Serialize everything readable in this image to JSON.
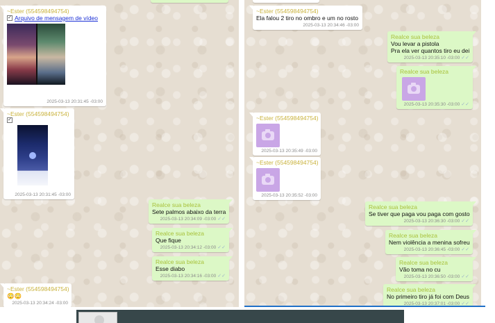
{
  "left_panel": {
    "messages": [
      {
        "id": "m1",
        "direction": "in",
        "kind": "video",
        "sender": "~Ester (554598494754)",
        "attachment_label": "Arquivo de mensagem de vídeo",
        "time": "2025-03-13 20:31:45 -03:00"
      },
      {
        "id": "m2",
        "direction": "in",
        "kind": "image",
        "sender": "~Ester (554598494754)",
        "time": "2025-03-13 20:31:45 -03:00"
      },
      {
        "id": "m3",
        "direction": "out",
        "kind": "text",
        "sender": "Realce sua beleza",
        "text": "Sete palmos abaixo da terra",
        "time": "2025-03-13 20:34:09 -03:00"
      },
      {
        "id": "m4",
        "direction": "out",
        "kind": "text",
        "sender": "Realce sua beleza",
        "text": "Que fique",
        "time": "2025-03-13 20:34:12 -03:00"
      },
      {
        "id": "m5",
        "direction": "out",
        "kind": "text",
        "sender": "Realce sua beleza",
        "text": "Esse diabo",
        "time": "2025-03-13 20:34:16 -03:00"
      },
      {
        "id": "m6",
        "direction": "in",
        "kind": "text",
        "sender": "~Ester (554598494754)",
        "text": "😳😳",
        "time": "2025-03-13 20:34:24 -03:00"
      }
    ]
  },
  "right_panel": {
    "messages": [
      {
        "id": "r1",
        "direction": "in",
        "kind": "text",
        "sender": "~Ester (554598494754)",
        "text": "Ela falou 2 tiro no ombro e um no rosto",
        "time": "2025-03-13 20:34:46 -03:00"
      },
      {
        "id": "r2",
        "direction": "out",
        "kind": "text",
        "sender": "Realce sua beleza",
        "text": "Vou levar a pistola",
        "text2": "Pra ela ver quantos tiro eu dei",
        "time": "2025-03-13 20:35:10 -03:00"
      },
      {
        "id": "r3",
        "direction": "out",
        "kind": "photo",
        "sender": "Realce sua beleza",
        "time": "2025-03-13 20:35:30 -03:00"
      },
      {
        "id": "r4",
        "direction": "in",
        "kind": "photo",
        "sender": "~Ester (554598494754)",
        "time": "2025-03-13 20:35:49 -03:00"
      },
      {
        "id": "r5",
        "direction": "in",
        "kind": "photo",
        "sender": "~Ester (554598494754)",
        "time": "2025-03-13 20:35:52 -03:00"
      },
      {
        "id": "r6",
        "direction": "out",
        "kind": "text",
        "sender": "Realce sua beleza",
        "text": "Se tiver que paga vou paga com gosto",
        "time": "2025-03-13 20:36:30 -03:00"
      },
      {
        "id": "r7",
        "direction": "out",
        "kind": "text",
        "sender": "Realce sua beleza",
        "text": "Nem violência a menina sofreu",
        "time": "2025-03-13 20:36:45 -03:00"
      },
      {
        "id": "r8",
        "direction": "out",
        "kind": "text",
        "sender": "Realce sua beleza",
        "text": "Vão toma no cu",
        "time": "2025-03-13 20:36:50 -03:00"
      },
      {
        "id": "r9",
        "direction": "out",
        "kind": "text",
        "sender": "Realce sua beleza",
        "text": "No primeiro tiro já foi com Deus",
        "time": "2025-03-13 20:37:01 -03:00"
      }
    ]
  },
  "icons": {
    "read_receipt": "double-check-icon",
    "photo_placeholder": "camera-icon",
    "attachment_checkbox": "checkbox-icon"
  },
  "colors": {
    "incoming_bubble": "#ffffff",
    "outgoing_bubble": "#dcf8c6",
    "incoming_sender": "#c9b23c",
    "outgoing_sender": "#a8c23b",
    "link": "#1a2fd6",
    "photo_placeholder": "#c9a6e6",
    "chat_background": "#e6ded2",
    "bottom_bar": "#37474a"
  }
}
